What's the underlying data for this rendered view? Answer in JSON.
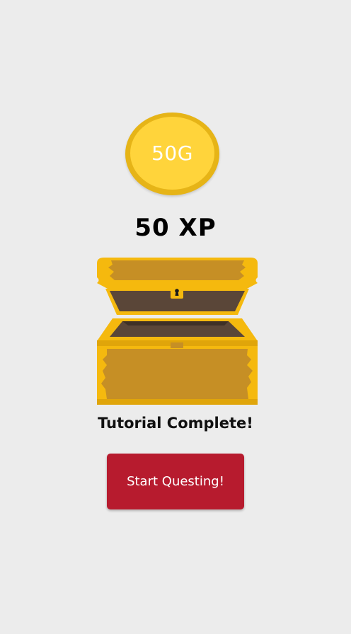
{
  "reward": {
    "gold_label": "50G",
    "xp_label": "50 XP"
  },
  "screen": {
    "title": "Tutorial Complete!",
    "cta_label": "Start Questing!"
  },
  "colors": {
    "background": "#ececec",
    "coin_outer": "#e6b417",
    "coin_inner": "#ffd43b",
    "chest_gold": "#f5b90e",
    "chest_wood": "#c68f25",
    "chest_interior": "#5a4638",
    "button": "#b71b2e"
  },
  "icons": {
    "coin": "gold-coin-icon",
    "chest": "treasure-chest-icon"
  }
}
